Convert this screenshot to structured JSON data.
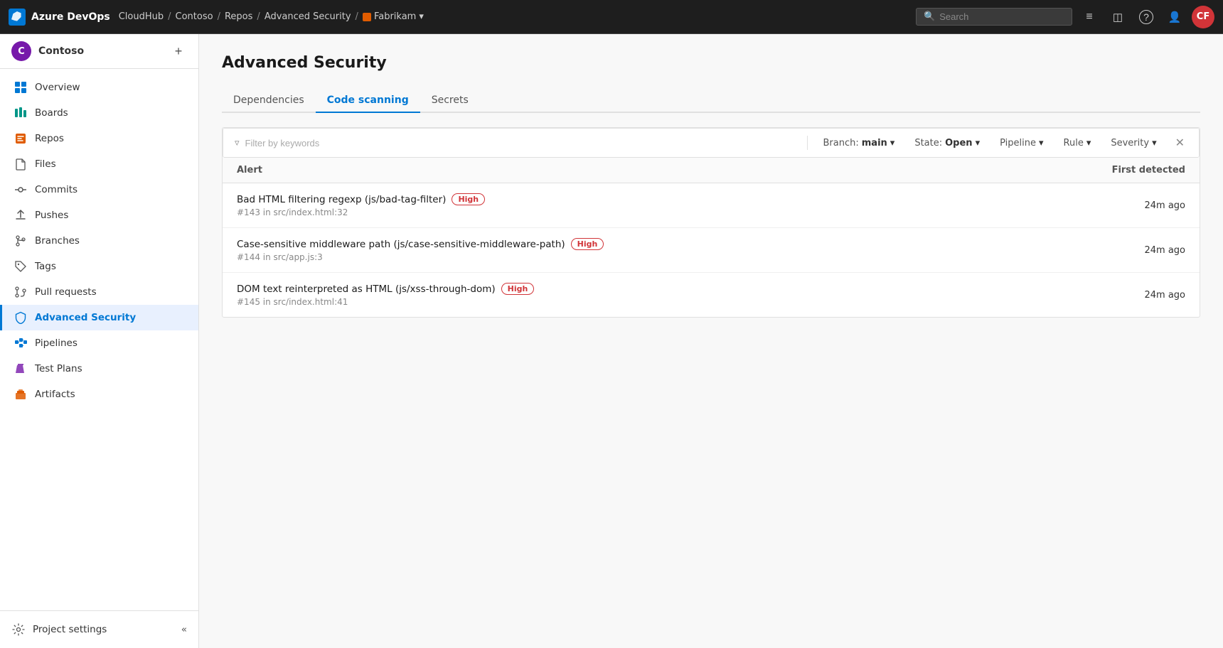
{
  "topbar": {
    "logo_label": "Azure DevOps",
    "brand": "Azure DevOps",
    "breadcrumb": {
      "org": "CloudHub",
      "sep1": "/",
      "project": "Contoso",
      "sep2": "/",
      "section": "Repos",
      "sep3": "/",
      "page": "Advanced Security",
      "sep4": "/",
      "repo": "Fabrikam",
      "repo_chevron": "▾"
    },
    "search_placeholder": "Search",
    "icons": {
      "list": "≡",
      "shop": "🛍",
      "help": "?",
      "account": "👤"
    },
    "avatar_initials": "CF"
  },
  "sidebar": {
    "org_avatar": "C",
    "org_name": "Contoso",
    "add_label": "+",
    "nav_items": [
      {
        "id": "overview",
        "label": "Overview",
        "icon": "overview"
      },
      {
        "id": "boards",
        "label": "Boards",
        "icon": "boards"
      },
      {
        "id": "repos",
        "label": "Repos",
        "icon": "repos"
      },
      {
        "id": "files",
        "label": "Files",
        "icon": "files"
      },
      {
        "id": "commits",
        "label": "Commits",
        "icon": "commits"
      },
      {
        "id": "pushes",
        "label": "Pushes",
        "icon": "pushes"
      },
      {
        "id": "branches",
        "label": "Branches",
        "icon": "branches"
      },
      {
        "id": "tags",
        "label": "Tags",
        "icon": "tags"
      },
      {
        "id": "pullrequests",
        "label": "Pull requests",
        "icon": "pullreqs"
      },
      {
        "id": "advancedsecurity",
        "label": "Advanced Security",
        "icon": "security",
        "active": true
      },
      {
        "id": "pipelines",
        "label": "Pipelines",
        "icon": "pipelines"
      },
      {
        "id": "testplans",
        "label": "Test Plans",
        "icon": "testplans"
      },
      {
        "id": "artifacts",
        "label": "Artifacts",
        "icon": "artifacts"
      }
    ],
    "project_settings_label": "Project settings",
    "collapse_icon": "«"
  },
  "main": {
    "page_title": "Advanced Security",
    "tabs": [
      {
        "id": "dependencies",
        "label": "Dependencies",
        "active": false
      },
      {
        "id": "codescanning",
        "label": "Code scanning",
        "active": true
      },
      {
        "id": "secrets",
        "label": "Secrets",
        "active": false
      }
    ],
    "filter": {
      "placeholder": "Filter by keywords",
      "filter_icon": "▽",
      "branch_label": "Branch:",
      "branch_value": "main",
      "state_label": "State:",
      "state_value": "Open",
      "pipeline_label": "Pipeline",
      "rule_label": "Rule",
      "severity_label": "Severity",
      "chevron": "▾",
      "close_icon": "✕"
    },
    "table": {
      "col_alert": "Alert",
      "col_first_detected": "First detected",
      "rows": [
        {
          "id": 1,
          "title": "Bad HTML filtering regexp (js/bad-tag-filter)",
          "severity": "High",
          "reference": "#143 in src/index.html:32",
          "first_detected": "24m ago"
        },
        {
          "id": 2,
          "title": "Case-sensitive middleware path (js/case-sensitive-middleware-path)",
          "severity": "High",
          "reference": "#144 in src/app.js:3",
          "first_detected": "24m ago"
        },
        {
          "id": 3,
          "title": "DOM text reinterpreted as HTML (js/xss-through-dom)",
          "severity": "High",
          "reference": "#145 in src/index.html:41",
          "first_detected": "24m ago"
        }
      ]
    }
  }
}
